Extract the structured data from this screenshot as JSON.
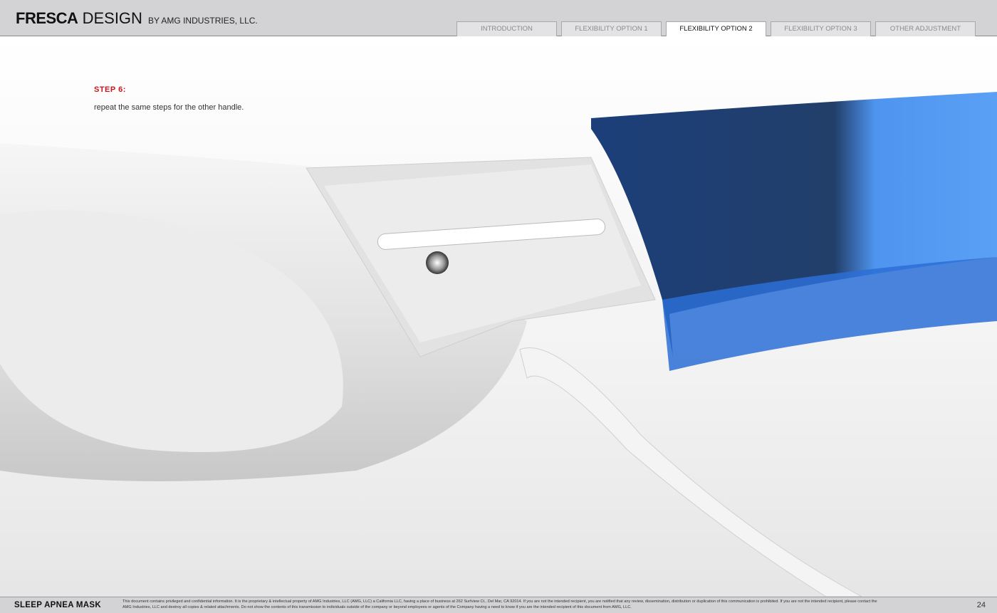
{
  "header": {
    "brand_bold": "FRESCA",
    "brand_light": "DESIGN",
    "brand_sub": "BY AMG INDUSTRIES, LLC.",
    "tabs": [
      {
        "label": "INTRODUCTION"
      },
      {
        "label": "FLEXIBILITY OPTION 1"
      },
      {
        "label": "FLEXIBILITY OPTION 2",
        "active": true
      },
      {
        "label": "FLEXIBILITY OPTION 3"
      },
      {
        "label": "OTHER ADJUSTMENT"
      }
    ]
  },
  "content": {
    "step_title": "STEP 6:",
    "step_text": "repeat the same steps for the other handle."
  },
  "footer": {
    "title": "SLEEP APNEA MASK",
    "legal": "This document contains privileged and confidential information. It is the proprietary & intellectual property of AMG Industries, LLC (AMG, LLC) a California LLC, having a place of business at 262 Surfview Ct., Del Mar, CA 92014. If you are not the intended recipient, you are notified that any review, dissemination, distribution or duplication of this communication is prohibited. If you are not the intended recipient, please contact the AMG Industries, LLC and destroy all copies & related attachments. Do not show the contents of this transmission to individuals outside of the company or beyond employees or agents of the Company having a need to know if you are the intended recipient of this document from AMG, LLC.",
    "page": "24"
  },
  "colors": {
    "accent": "#c8161d",
    "header_bg": "#d3d3d5",
    "blue": "#2b6fd6"
  }
}
